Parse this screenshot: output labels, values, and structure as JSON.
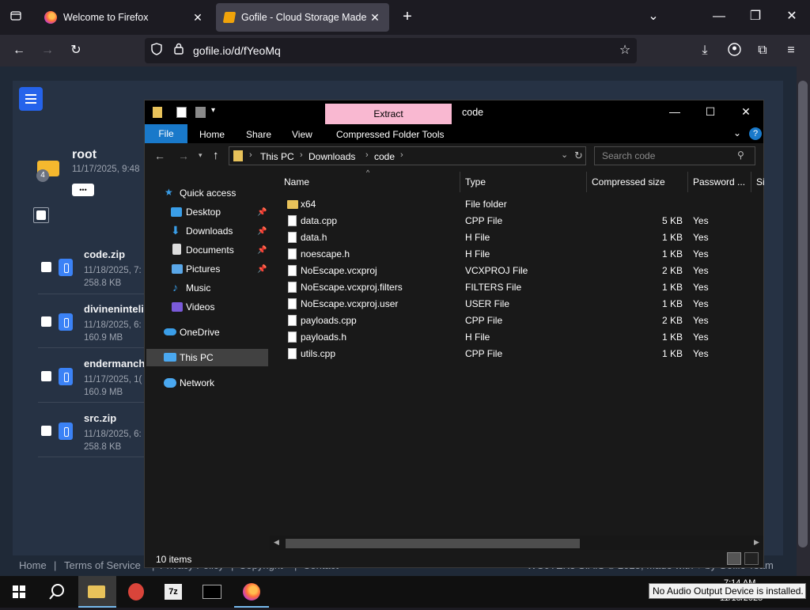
{
  "browser": {
    "tabs": [
      {
        "title": "Welcome to Firefox",
        "active": false
      },
      {
        "title": "Gofile - Cloud Storage Made Si",
        "active": true
      }
    ],
    "url": "gofile.io/d/fYeoMq"
  },
  "gofile": {
    "folder": {
      "name": "root",
      "date": "11/17/2025, 9:48",
      "badge": "4",
      "more": "•••"
    },
    "files": [
      {
        "name": "code.zip",
        "date": "11/18/2025, 7:",
        "size": "258.8 KB"
      },
      {
        "name": "divineninteli",
        "date": "11/18/2025, 6:",
        "size": "160.9 MB"
      },
      {
        "name": "endermanch",
        "date": "11/17/2025, 1(",
        "size": "160.9 MB"
      },
      {
        "name": "src.zip",
        "date": "11/18/2025, 6:",
        "size": "258.8 KB"
      }
    ],
    "footer": {
      "links": [
        "Home",
        "Terms of Service",
        "Privacy Policy",
        "Copyright",
        "Contact"
      ],
      "right": "WOJTEK3 S.A.S © 2025, Made with ♥ by Gofile Team"
    }
  },
  "explorer": {
    "title": "code",
    "extract_label": "Extract",
    "ribbon_tabs": [
      "File",
      "Home",
      "Share",
      "View",
      "Compressed Folder Tools"
    ],
    "breadcrumb": [
      "This PC",
      "Downloads",
      "code"
    ],
    "search_placeholder": "Search code",
    "nav": {
      "quick_access": "Quick access",
      "pinned": [
        "Desktop",
        "Downloads",
        "Documents",
        "Pictures"
      ],
      "unpinned": [
        "Music",
        "Videos"
      ],
      "onedrive": "OneDrive",
      "thispc": "This PC",
      "network": "Network"
    },
    "columns": [
      "Name",
      "Type",
      "Compressed size",
      "Password ...",
      "Si"
    ],
    "rows": [
      {
        "name": "x64",
        "type": "File folder",
        "size": "",
        "password": "",
        "folder": true
      },
      {
        "name": "data.cpp",
        "type": "CPP File",
        "size": "5 KB",
        "password": "Yes"
      },
      {
        "name": "data.h",
        "type": "H File",
        "size": "1 KB",
        "password": "Yes"
      },
      {
        "name": "noescape.h",
        "type": "H File",
        "size": "1 KB",
        "password": "Yes"
      },
      {
        "name": "NoEscape.vcxproj",
        "type": "VCXPROJ File",
        "size": "2 KB",
        "password": "Yes"
      },
      {
        "name": "NoEscape.vcxproj.filters",
        "type": "FILTERS File",
        "size": "1 KB",
        "password": "Yes"
      },
      {
        "name": "NoEscape.vcxproj.user",
        "type": "USER File",
        "size": "1 KB",
        "password": "Yes"
      },
      {
        "name": "payloads.cpp",
        "type": "CPP File",
        "size": "2 KB",
        "password": "Yes"
      },
      {
        "name": "payloads.h",
        "type": "H File",
        "size": "1 KB",
        "password": "Yes"
      },
      {
        "name": "utils.cpp",
        "type": "CPP File",
        "size": "1 KB",
        "password": "Yes"
      }
    ],
    "status": "10 items"
  },
  "taskbar": {
    "time": "7:14 AM",
    "date": "11/18/2025",
    "tooltip": "No Audio Output Device is installed."
  },
  "colors": {
    "accent_blue": "#2563eb",
    "extract_pink": "#f9b8d1",
    "file_tab_blue": "#1979ca"
  }
}
